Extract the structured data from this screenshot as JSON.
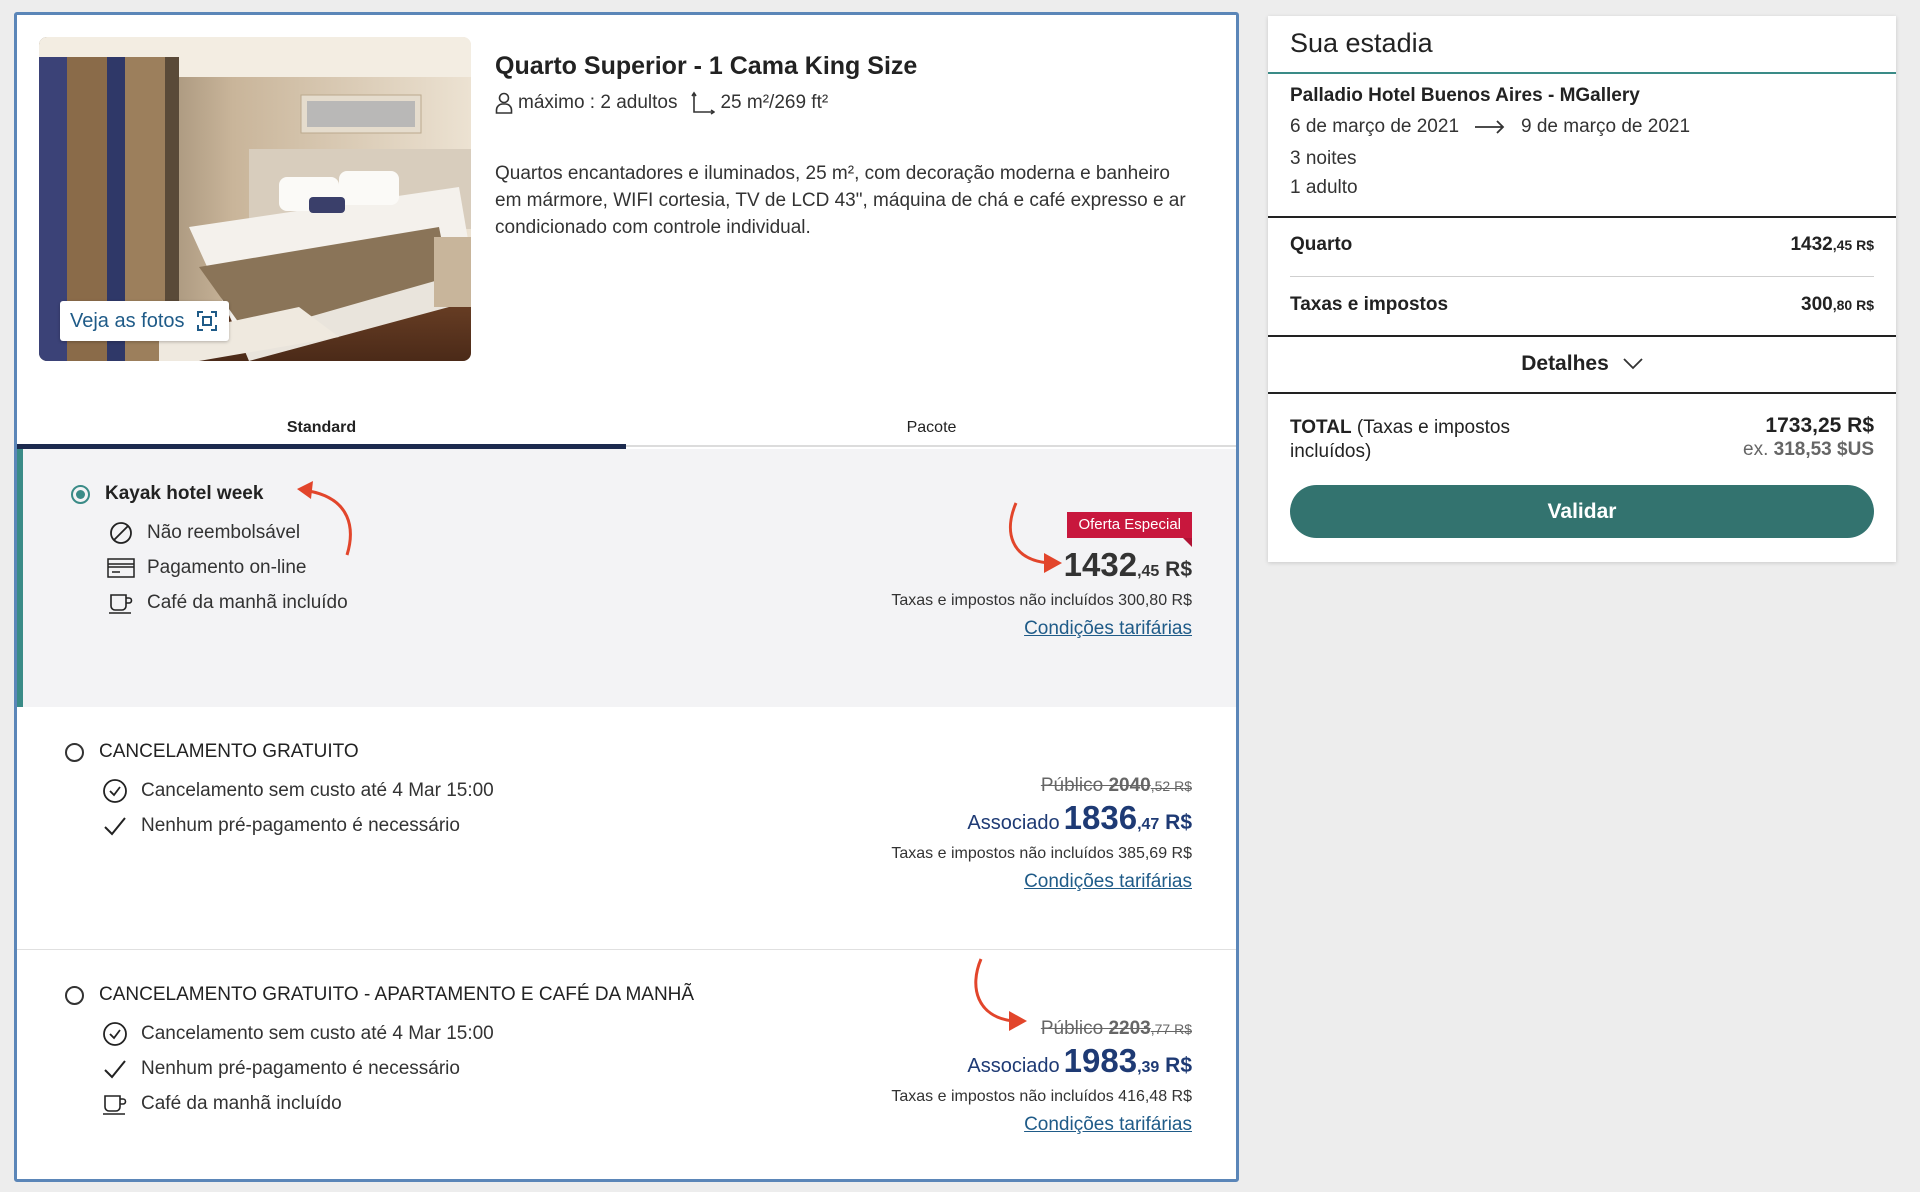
{
  "room": {
    "title": "Quarto Superior - 1 Cama King Size",
    "capacity": "máximo : 2 adultos",
    "size": "25 m²/269 ft²",
    "description": "Quartos encantadores e iluminados, 25 m², com decoração moderna e banheiro em mármore, WIFI cortesia, TV de LCD 43\", máquina de chá e café expresso e ar condicionado com controle individual.",
    "photos_label": "Veja as fotos"
  },
  "tabs": [
    {
      "label": "Standard",
      "active": true
    },
    {
      "label": "Pacote",
      "active": false
    }
  ],
  "rates": [
    {
      "name": "Kayak hotel week",
      "selected": true,
      "features": [
        {
          "icon": "no-refund-icon",
          "text": "Não reembolsável"
        },
        {
          "icon": "credit-card-icon",
          "text": "Pagamento on-line"
        },
        {
          "icon": "coffee-cup-icon",
          "text": "Café da manhã incluído"
        }
      ],
      "badge": "Oferta Especial",
      "price_int": "1432",
      "price_dec": ",45",
      "currency": " R$",
      "tax_note": "Taxas e impostos não incluídos 300,80 R$",
      "conditions": "Condições tarifárias"
    },
    {
      "name": "CANCELAMENTO GRATUITO",
      "selected": false,
      "features": [
        {
          "icon": "clock-check-icon",
          "text": "Cancelamento sem custo até 4 Mar 15:00"
        },
        {
          "icon": "checkmark-icon",
          "text": "Nenhum pré-pagamento é necessário"
        }
      ],
      "public_label": "Público ",
      "public_int": "2040",
      "public_dec": ",52 R$",
      "assoc_label": "Associado",
      "price_int": "1836",
      "price_dec": ",47",
      "currency": " R$",
      "tax_note": "Taxas e impostos não incluídos 385,69 R$",
      "conditions": "Condições tarifárias"
    },
    {
      "name": "CANCELAMENTO GRATUITO - APARTAMENTO E CAFÉ DA MANHÃ",
      "selected": false,
      "features": [
        {
          "icon": "clock-check-icon",
          "text": "Cancelamento sem custo até 4 Mar 15:00"
        },
        {
          "icon": "checkmark-icon",
          "text": "Nenhum pré-pagamento é necessário"
        },
        {
          "icon": "coffee-cup-icon",
          "text": "Café da manhã incluído"
        }
      ],
      "public_label": "Público ",
      "public_int": "2203",
      "public_dec": ",77 R$",
      "assoc_label": "Associado",
      "price_int": "1983",
      "price_dec": ",39",
      "currency": " R$",
      "tax_note": "Taxas e impostos não incluídos 416,48 R$",
      "conditions": "Condições tarifárias"
    }
  ],
  "summary": {
    "title": "Sua estadia",
    "hotel": "Palladio Hotel Buenos Aires - MGallery",
    "checkin": "6 de março de 2021",
    "checkout": "9 de março de 2021",
    "nights": "3 noites",
    "guests": "1 adulto",
    "room_label": "Quarto",
    "room_int": "1432",
    "room_dec": ",45 R$",
    "tax_label": "Taxas e impostos",
    "tax_int": "300",
    "tax_dec": ",80 R$",
    "details_label": "Detalhes",
    "total_label": "TOTAL",
    "total_note": " (Taxas e impostos incluídos)",
    "total_value": "1733,25 R$",
    "total_ex_label": "ex. ",
    "total_ex_value": "318,53 $US",
    "validate_label": "Validar"
  },
  "colors": {
    "accent_teal": "#33736f",
    "badge_red": "#c8173d",
    "link_blue": "#1f5b88",
    "associate_blue": "#1e3a74",
    "annotation_arrow": "#e2452b"
  }
}
